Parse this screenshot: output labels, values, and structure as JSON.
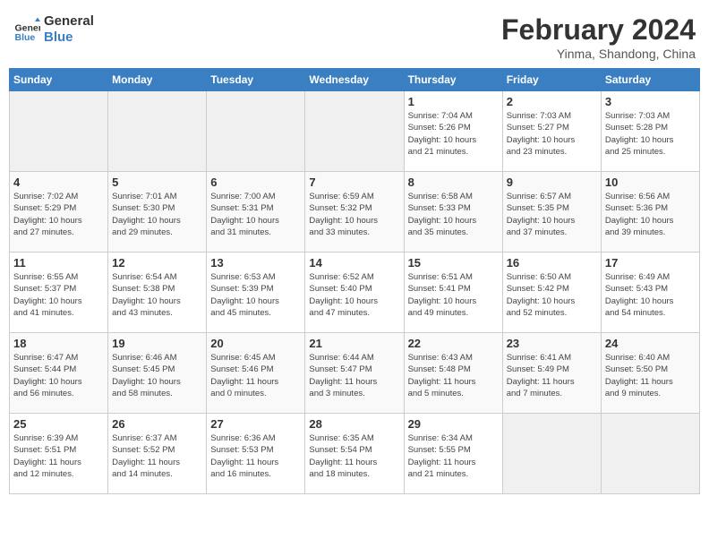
{
  "header": {
    "logo_line1": "General",
    "logo_line2": "Blue",
    "title": "February 2024",
    "subtitle": "Yinma, Shandong, China"
  },
  "weekdays": [
    "Sunday",
    "Monday",
    "Tuesday",
    "Wednesday",
    "Thursday",
    "Friday",
    "Saturday"
  ],
  "weeks": [
    [
      {
        "num": "",
        "info": ""
      },
      {
        "num": "",
        "info": ""
      },
      {
        "num": "",
        "info": ""
      },
      {
        "num": "",
        "info": ""
      },
      {
        "num": "1",
        "info": "Sunrise: 7:04 AM\nSunset: 5:26 PM\nDaylight: 10 hours\nand 21 minutes."
      },
      {
        "num": "2",
        "info": "Sunrise: 7:03 AM\nSunset: 5:27 PM\nDaylight: 10 hours\nand 23 minutes."
      },
      {
        "num": "3",
        "info": "Sunrise: 7:03 AM\nSunset: 5:28 PM\nDaylight: 10 hours\nand 25 minutes."
      }
    ],
    [
      {
        "num": "4",
        "info": "Sunrise: 7:02 AM\nSunset: 5:29 PM\nDaylight: 10 hours\nand 27 minutes."
      },
      {
        "num": "5",
        "info": "Sunrise: 7:01 AM\nSunset: 5:30 PM\nDaylight: 10 hours\nand 29 minutes."
      },
      {
        "num": "6",
        "info": "Sunrise: 7:00 AM\nSunset: 5:31 PM\nDaylight: 10 hours\nand 31 minutes."
      },
      {
        "num": "7",
        "info": "Sunrise: 6:59 AM\nSunset: 5:32 PM\nDaylight: 10 hours\nand 33 minutes."
      },
      {
        "num": "8",
        "info": "Sunrise: 6:58 AM\nSunset: 5:33 PM\nDaylight: 10 hours\nand 35 minutes."
      },
      {
        "num": "9",
        "info": "Sunrise: 6:57 AM\nSunset: 5:35 PM\nDaylight: 10 hours\nand 37 minutes."
      },
      {
        "num": "10",
        "info": "Sunrise: 6:56 AM\nSunset: 5:36 PM\nDaylight: 10 hours\nand 39 minutes."
      }
    ],
    [
      {
        "num": "11",
        "info": "Sunrise: 6:55 AM\nSunset: 5:37 PM\nDaylight: 10 hours\nand 41 minutes."
      },
      {
        "num": "12",
        "info": "Sunrise: 6:54 AM\nSunset: 5:38 PM\nDaylight: 10 hours\nand 43 minutes."
      },
      {
        "num": "13",
        "info": "Sunrise: 6:53 AM\nSunset: 5:39 PM\nDaylight: 10 hours\nand 45 minutes."
      },
      {
        "num": "14",
        "info": "Sunrise: 6:52 AM\nSunset: 5:40 PM\nDaylight: 10 hours\nand 47 minutes."
      },
      {
        "num": "15",
        "info": "Sunrise: 6:51 AM\nSunset: 5:41 PM\nDaylight: 10 hours\nand 49 minutes."
      },
      {
        "num": "16",
        "info": "Sunrise: 6:50 AM\nSunset: 5:42 PM\nDaylight: 10 hours\nand 52 minutes."
      },
      {
        "num": "17",
        "info": "Sunrise: 6:49 AM\nSunset: 5:43 PM\nDaylight: 10 hours\nand 54 minutes."
      }
    ],
    [
      {
        "num": "18",
        "info": "Sunrise: 6:47 AM\nSunset: 5:44 PM\nDaylight: 10 hours\nand 56 minutes."
      },
      {
        "num": "19",
        "info": "Sunrise: 6:46 AM\nSunset: 5:45 PM\nDaylight: 10 hours\nand 58 minutes."
      },
      {
        "num": "20",
        "info": "Sunrise: 6:45 AM\nSunset: 5:46 PM\nDaylight: 11 hours\nand 0 minutes."
      },
      {
        "num": "21",
        "info": "Sunrise: 6:44 AM\nSunset: 5:47 PM\nDaylight: 11 hours\nand 3 minutes."
      },
      {
        "num": "22",
        "info": "Sunrise: 6:43 AM\nSunset: 5:48 PM\nDaylight: 11 hours\nand 5 minutes."
      },
      {
        "num": "23",
        "info": "Sunrise: 6:41 AM\nSunset: 5:49 PM\nDaylight: 11 hours\nand 7 minutes."
      },
      {
        "num": "24",
        "info": "Sunrise: 6:40 AM\nSunset: 5:50 PM\nDaylight: 11 hours\nand 9 minutes."
      }
    ],
    [
      {
        "num": "25",
        "info": "Sunrise: 6:39 AM\nSunset: 5:51 PM\nDaylight: 11 hours\nand 12 minutes."
      },
      {
        "num": "26",
        "info": "Sunrise: 6:37 AM\nSunset: 5:52 PM\nDaylight: 11 hours\nand 14 minutes."
      },
      {
        "num": "27",
        "info": "Sunrise: 6:36 AM\nSunset: 5:53 PM\nDaylight: 11 hours\nand 16 minutes."
      },
      {
        "num": "28",
        "info": "Sunrise: 6:35 AM\nSunset: 5:54 PM\nDaylight: 11 hours\nand 18 minutes."
      },
      {
        "num": "29",
        "info": "Sunrise: 6:34 AM\nSunset: 5:55 PM\nDaylight: 11 hours\nand 21 minutes."
      },
      {
        "num": "",
        "info": ""
      },
      {
        "num": "",
        "info": ""
      }
    ]
  ]
}
